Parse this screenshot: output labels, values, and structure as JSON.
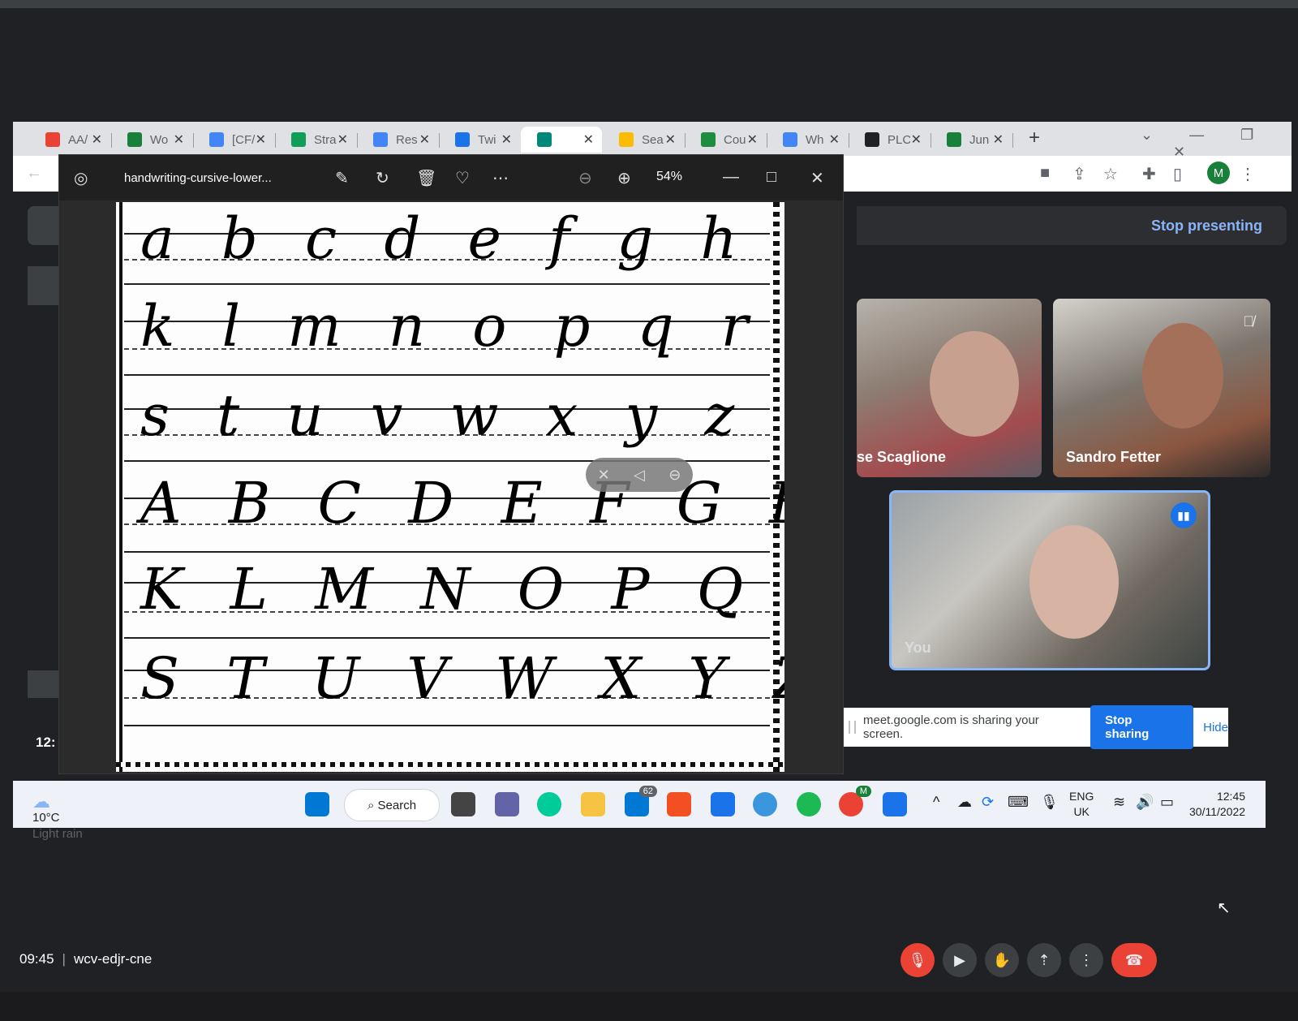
{
  "browser": {
    "tabs": [
      {
        "label": "AA/",
        "color": "#ea4335",
        "icon": "gmail-icon"
      },
      {
        "label": "Wo",
        "color": "#188038",
        "icon": "docs-icon"
      },
      {
        "label": "[CF/",
        "color": "#4285f4",
        "icon": "diamond-icon"
      },
      {
        "label": "Stra",
        "color": "#0f9d58",
        "icon": "sheets-icon"
      },
      {
        "label": "Res",
        "color": "#4285f4",
        "icon": "gear-icon"
      },
      {
        "label": "Twi",
        "color": "#1a73e8",
        "icon": "calendar-icon"
      },
      {
        "label": "",
        "color": "#00897b",
        "icon": "meet-icon",
        "active": true
      },
      {
        "label": "Sea",
        "color": "#fbbc04",
        "icon": "drive-icon"
      },
      {
        "label": "Cou",
        "color": "#1e8e3e",
        "icon": "classroom-icon"
      },
      {
        "label": "Wh",
        "color": "#4285f4",
        "icon": "chat-icon"
      },
      {
        "label": "PLC",
        "color": "#202124",
        "icon": "c-icon"
      },
      {
        "label": "Jun",
        "color": "#188038",
        "icon": "s-icon"
      }
    ],
    "profile_initial": "M"
  },
  "viewer": {
    "title": "handwriting-cursive-lower...",
    "zoom": "54%",
    "rows": [
      "a b c d e f g h i j",
      "k l m n o p q r",
      "s t u v w x y z",
      "A B C D E F G H I J",
      "K L M N O P Q R",
      "S T U V W X Y Z"
    ]
  },
  "meet": {
    "stop_presenting": "Stop presenting",
    "participants": [
      {
        "name": "se Scaglione"
      },
      {
        "name": "Sandro Fetter"
      },
      {
        "name": "You"
      }
    ],
    "share_text": "meet.google.com is sharing your screen.",
    "stop_sharing": "Stop sharing",
    "hide": "Hide",
    "inner_clock": "12:",
    "time": "09:45",
    "meeting_code": "wcv-edjr-cne"
  },
  "taskbar": {
    "weather_temp": "10°C",
    "weather_desc": "Light rain",
    "search": "Search",
    "mail_badge": "62",
    "chrome_badge": "M",
    "lang1": "ENG",
    "lang2": "UK",
    "time": "12:45",
    "date": "30/11/2022"
  }
}
